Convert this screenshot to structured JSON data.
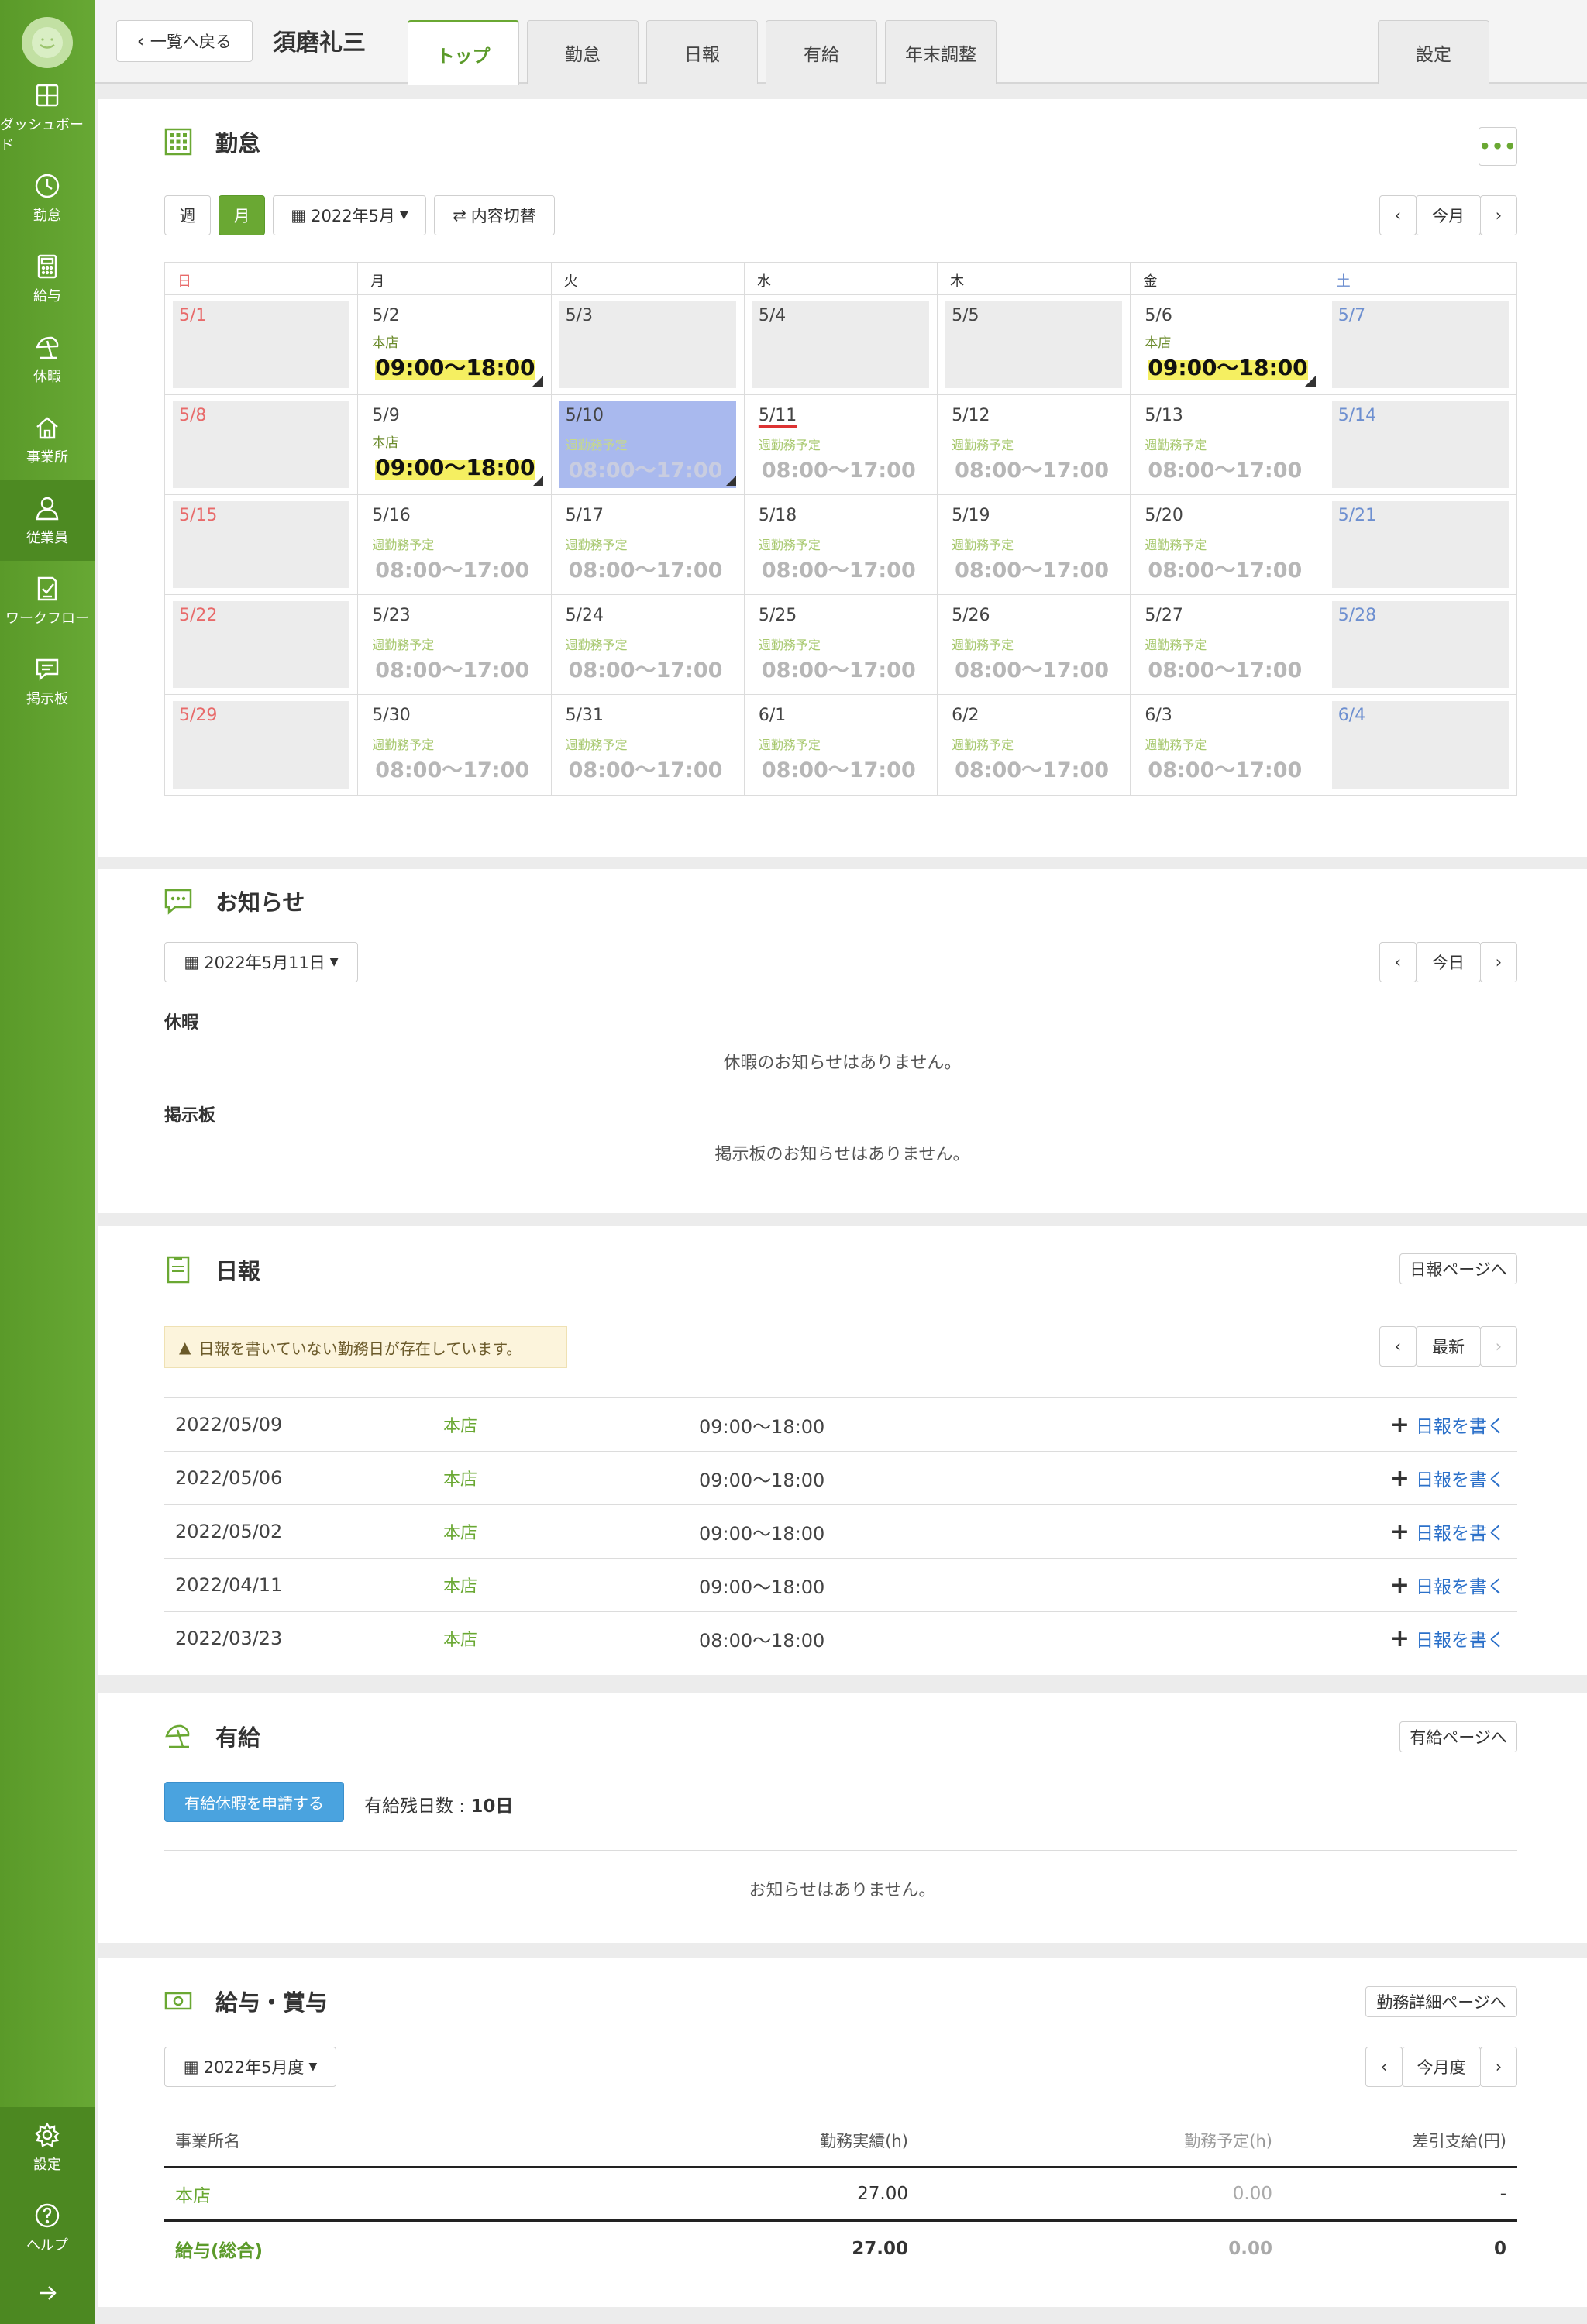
{
  "sidebar": {
    "items": [
      {
        "label": "ダッシュボード",
        "icon": "dashboard-icon"
      },
      {
        "label": "勤怠",
        "icon": "clock-icon"
      },
      {
        "label": "給与",
        "icon": "calculator-icon"
      },
      {
        "label": "休暇",
        "icon": "parasol-icon"
      },
      {
        "label": "事業所",
        "icon": "home-icon"
      },
      {
        "label": "従業員",
        "icon": "person-icon"
      },
      {
        "label": "ワークフロー",
        "icon": "checklist-icon"
      },
      {
        "label": "掲示板",
        "icon": "chat-icon"
      }
    ],
    "settings": "設定",
    "help": "ヘルプ"
  },
  "header": {
    "back": "一覧へ戻る",
    "name": "須磨礼三",
    "tabs": [
      "トップ",
      "勤怠",
      "日報",
      "有給",
      "年末調整"
    ],
    "settings_tab": "設定"
  },
  "attendance": {
    "title": "勤怠",
    "week": "週",
    "month": "月",
    "month_select": "2022年5月",
    "toggle": "内容切替",
    "this_month": "今月",
    "weekdays": [
      "日",
      "月",
      "火",
      "水",
      "木",
      "金",
      "土"
    ],
    "shop": "本店",
    "worked": "09:00～18:00",
    "planned_label": "週勤務予定",
    "planned": "08:00～17:00",
    "weeks": [
      [
        "5/1",
        "5/2",
        "5/3",
        "5/4",
        "5/5",
        "5/6",
        "5/7"
      ],
      [
        "5/8",
        "5/9",
        "5/10",
        "5/11",
        "5/12",
        "5/13",
        "5/14"
      ],
      [
        "5/15",
        "5/16",
        "5/17",
        "5/18",
        "5/19",
        "5/20",
        "5/21"
      ],
      [
        "5/22",
        "5/23",
        "5/24",
        "5/25",
        "5/26",
        "5/27",
        "5/28"
      ],
      [
        "5/29",
        "5/30",
        "5/31",
        "6/1",
        "6/2",
        "6/3",
        "6/4"
      ]
    ]
  },
  "notices": {
    "title": "お知らせ",
    "date_select": "2022年5月11日",
    "today": "今日",
    "vacation_label": "休暇",
    "vacation_empty": "休暇のお知らせはありません。",
    "board_label": "掲示板",
    "board_empty": "掲示板のお知らせはありません。"
  },
  "daily": {
    "title": "日報",
    "page_link": "日報ページへ",
    "warning": "日報を書いていない勤務日が存在しています。",
    "latest": "最新",
    "write": "日報を書く",
    "rows": [
      {
        "date": "2022/05/09",
        "shop": "本店",
        "time": "09:00～18:00"
      },
      {
        "date": "2022/05/06",
        "shop": "本店",
        "time": "09:00～18:00"
      },
      {
        "date": "2022/05/02",
        "shop": "本店",
        "time": "09:00～18:00"
      },
      {
        "date": "2022/04/11",
        "shop": "本店",
        "time": "09:00～18:00"
      },
      {
        "date": "2022/03/23",
        "shop": "本店",
        "time": "08:00～18:00"
      }
    ]
  },
  "paid_leave": {
    "title": "有給",
    "page_link": "有給ページへ",
    "apply": "有給休暇を申請する",
    "remaining_label": "有給残日数 : ",
    "remaining_value": "10日",
    "empty": "お知らせはありません。"
  },
  "salary": {
    "title": "給与・賞与",
    "page_link": "勤務詳細ページへ",
    "period_select": "2022年5月度",
    "this_period": "今月度",
    "headers": [
      "事業所名",
      "勤務実績(h)",
      "勤務予定(h)",
      "差引支給(円)"
    ],
    "rows": [
      {
        "name": "本店",
        "actual": "27.00",
        "planned": "0.00",
        "pay": "-"
      }
    ],
    "total": {
      "name": "給与(総合)",
      "actual": "27.00",
      "planned": "0.00",
      "pay": "0"
    }
  }
}
